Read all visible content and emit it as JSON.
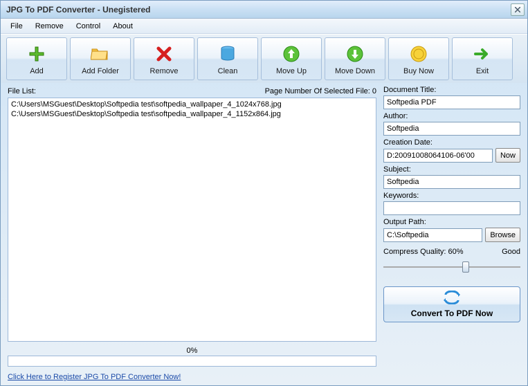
{
  "window": {
    "title": "JPG To PDF Converter - Unegistered"
  },
  "menu": {
    "file": "File",
    "remove": "Remove",
    "control": "Control",
    "about": "About"
  },
  "toolbar": {
    "add": "Add",
    "add_folder": "Add Folder",
    "remove": "Remove",
    "clean": "Clean",
    "move_up": "Move Up",
    "move_down": "Move Down",
    "buy_now": "Buy Now",
    "exit": "Exit"
  },
  "filelist": {
    "label": "File List:",
    "page_number_label": "Page Number Of Selected File: 0",
    "items": [
      "C:\\Users\\MSGuest\\Desktop\\Softpedia test\\softpedia_wallpaper_4_1024x768.jpg",
      "C:\\Users\\MSGuest\\Desktop\\Softpedia test\\softpedia_wallpaper_4_1152x864.jpg"
    ]
  },
  "progress": {
    "label": "0%"
  },
  "right": {
    "doc_title_label": "Document Title:",
    "doc_title": "Softpedia PDF",
    "author_label": "Author:",
    "author": "Softpedia",
    "creation_date_label": "Creation Date:",
    "creation_date": "D:20091008064106-06'00",
    "now_btn": "Now",
    "subject_label": "Subject:",
    "subject": "Softpedia",
    "keywords_label": "Keywords:",
    "keywords": "",
    "output_path_label": "Output Path:",
    "output_path": "C:\\Softpedia",
    "browse_btn": "Browse",
    "compress_label": "Compress Quality: 60%",
    "compress_rating": "Good",
    "convert_btn": "Convert To PDF Now"
  },
  "footer": {
    "register_link": "Click Here to Register JPG To PDF Converter Now!"
  }
}
